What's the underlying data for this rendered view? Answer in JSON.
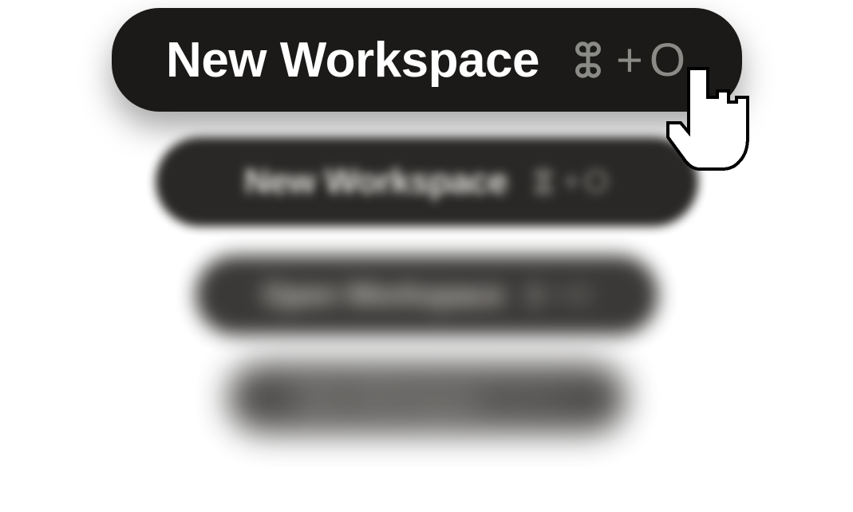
{
  "items": [
    {
      "label": "New Workspace",
      "shortcut_plus": "+",
      "shortcut_key": "O"
    },
    {
      "label": "New Workspace",
      "shortcut_plus": "+",
      "shortcut_key": "O"
    },
    {
      "label": "Open Workspace",
      "shortcut_plus": "+",
      "shortcut_key": "O"
    },
    {
      "label": "New Workspace",
      "shortcut_plus": "+",
      "shortcut_key": "O"
    }
  ],
  "icons": {
    "command": "command-icon",
    "pointer": "pointing-hand-cursor"
  }
}
